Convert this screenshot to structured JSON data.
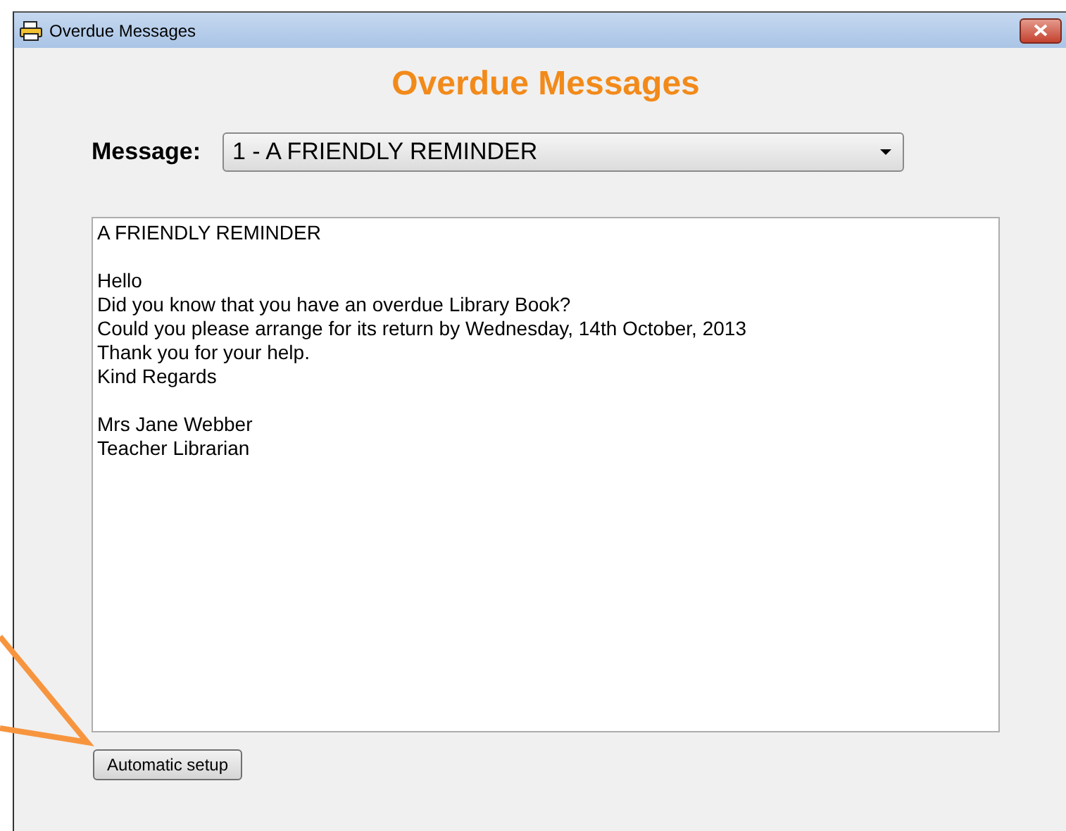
{
  "window": {
    "title": "Overdue Messages"
  },
  "heading": "Overdue Messages",
  "message_select": {
    "label": "Message:",
    "value": "1 - A FRIENDLY REMINDER"
  },
  "message_body": {
    "paragraphs": [
      [
        "A FRIENDLY REMINDER"
      ],
      [
        "Hello",
        "Did you know that you have an overdue Library Book?",
        "Could you please arrange for its return by Wednesday, 14th October, 2013",
        "Thank you for your help.",
        "Kind Regards"
      ],
      [
        "Mrs Jane Webber",
        "Teacher Librarian"
      ]
    ]
  },
  "buttons": [
    "Automatic setup"
  ]
}
